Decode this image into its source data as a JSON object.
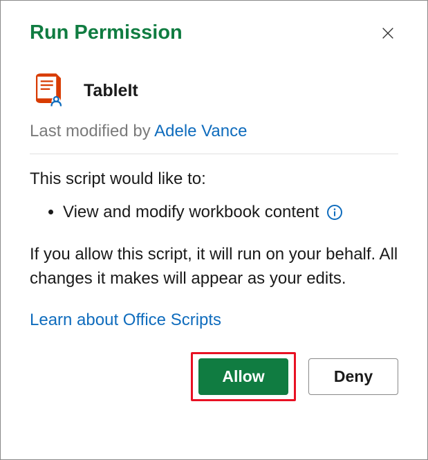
{
  "dialog": {
    "title": "Run Permission",
    "script_name": "TableIt",
    "modified_prefix": "Last modified by ",
    "modified_author": "Adele Vance",
    "permissions_intro": "This script would like to:",
    "permissions": [
      "View and modify workbook content"
    ],
    "disclaimer": "If you allow this script, it will run on your behalf. All changes it makes will appear as your edits.",
    "learn_link": "Learn about Office Scripts",
    "buttons": {
      "allow": "Allow",
      "deny": "Deny"
    }
  }
}
